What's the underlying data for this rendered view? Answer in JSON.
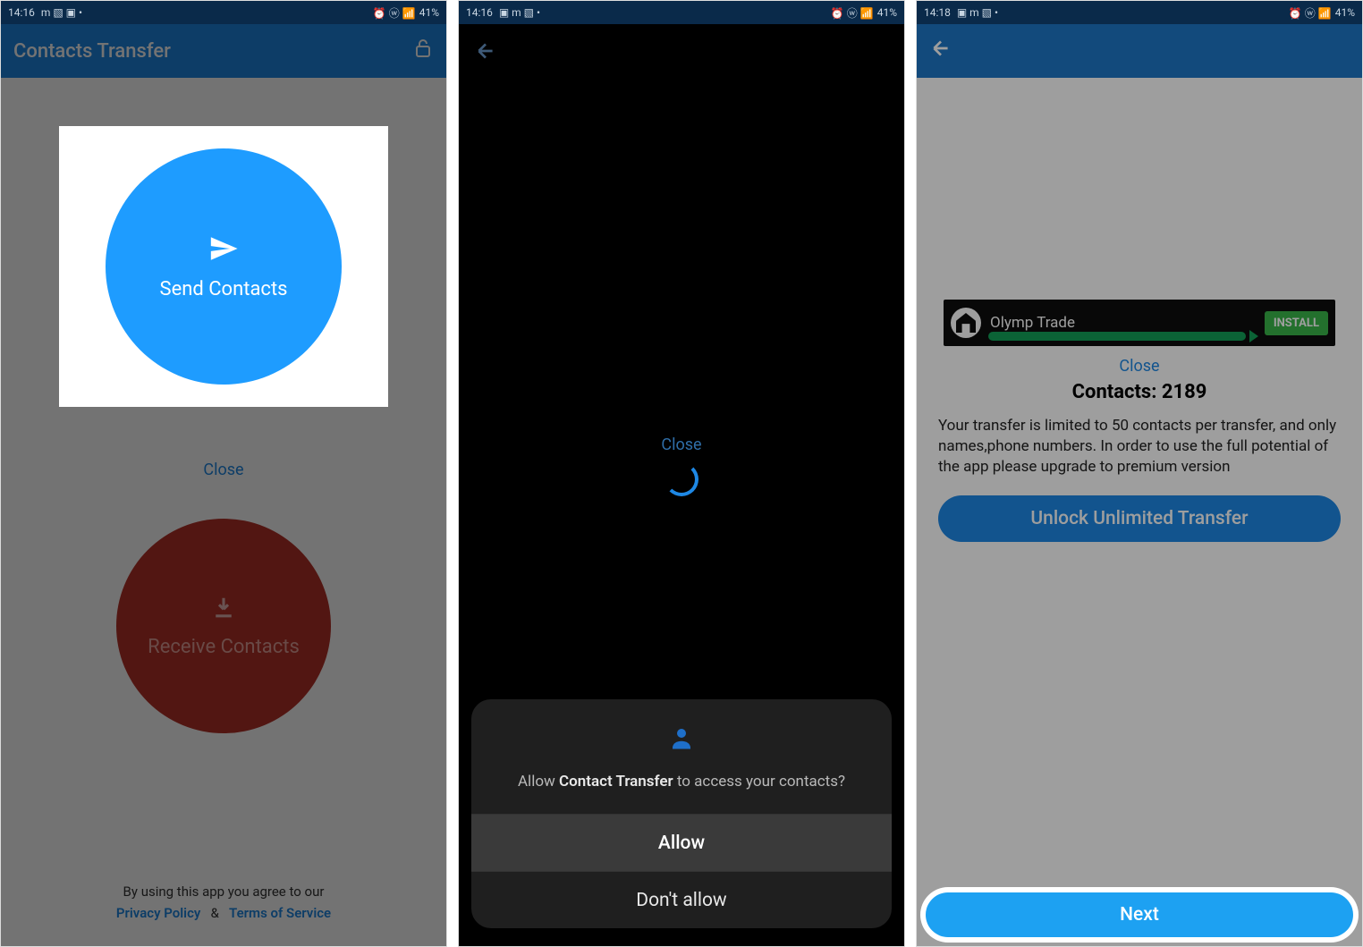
{
  "status": {
    "time1": "14:16",
    "time2": "14:16",
    "time3": "14:18",
    "battery": "41%"
  },
  "screen1": {
    "title": "Contacts Transfer",
    "send_label": "Send Contacts",
    "close": "Close",
    "receive_label": "Receive Contacts",
    "agree_text": "By using this app you agree to our",
    "privacy": "Privacy Policy",
    "amp": "&",
    "tos": "Terms of Service"
  },
  "screen2": {
    "close": "Close",
    "perm_prefix": "Allow ",
    "perm_app": "Contact Transfer",
    "perm_suffix": " to access your contacts?",
    "allow": "Allow",
    "deny": "Don't allow"
  },
  "screen3": {
    "ad_title": "Olymp Trade",
    "install": "INSTALL",
    "close": "Close",
    "contacts_label": "Contacts: 2189",
    "limit_text": "Your transfer is limited to 50 contacts per transfer, and only names,phone numbers. In order to use the full potential of the app please upgrade to premium version",
    "unlock": "Unlock Unlimited Transfer",
    "next": "Next"
  }
}
